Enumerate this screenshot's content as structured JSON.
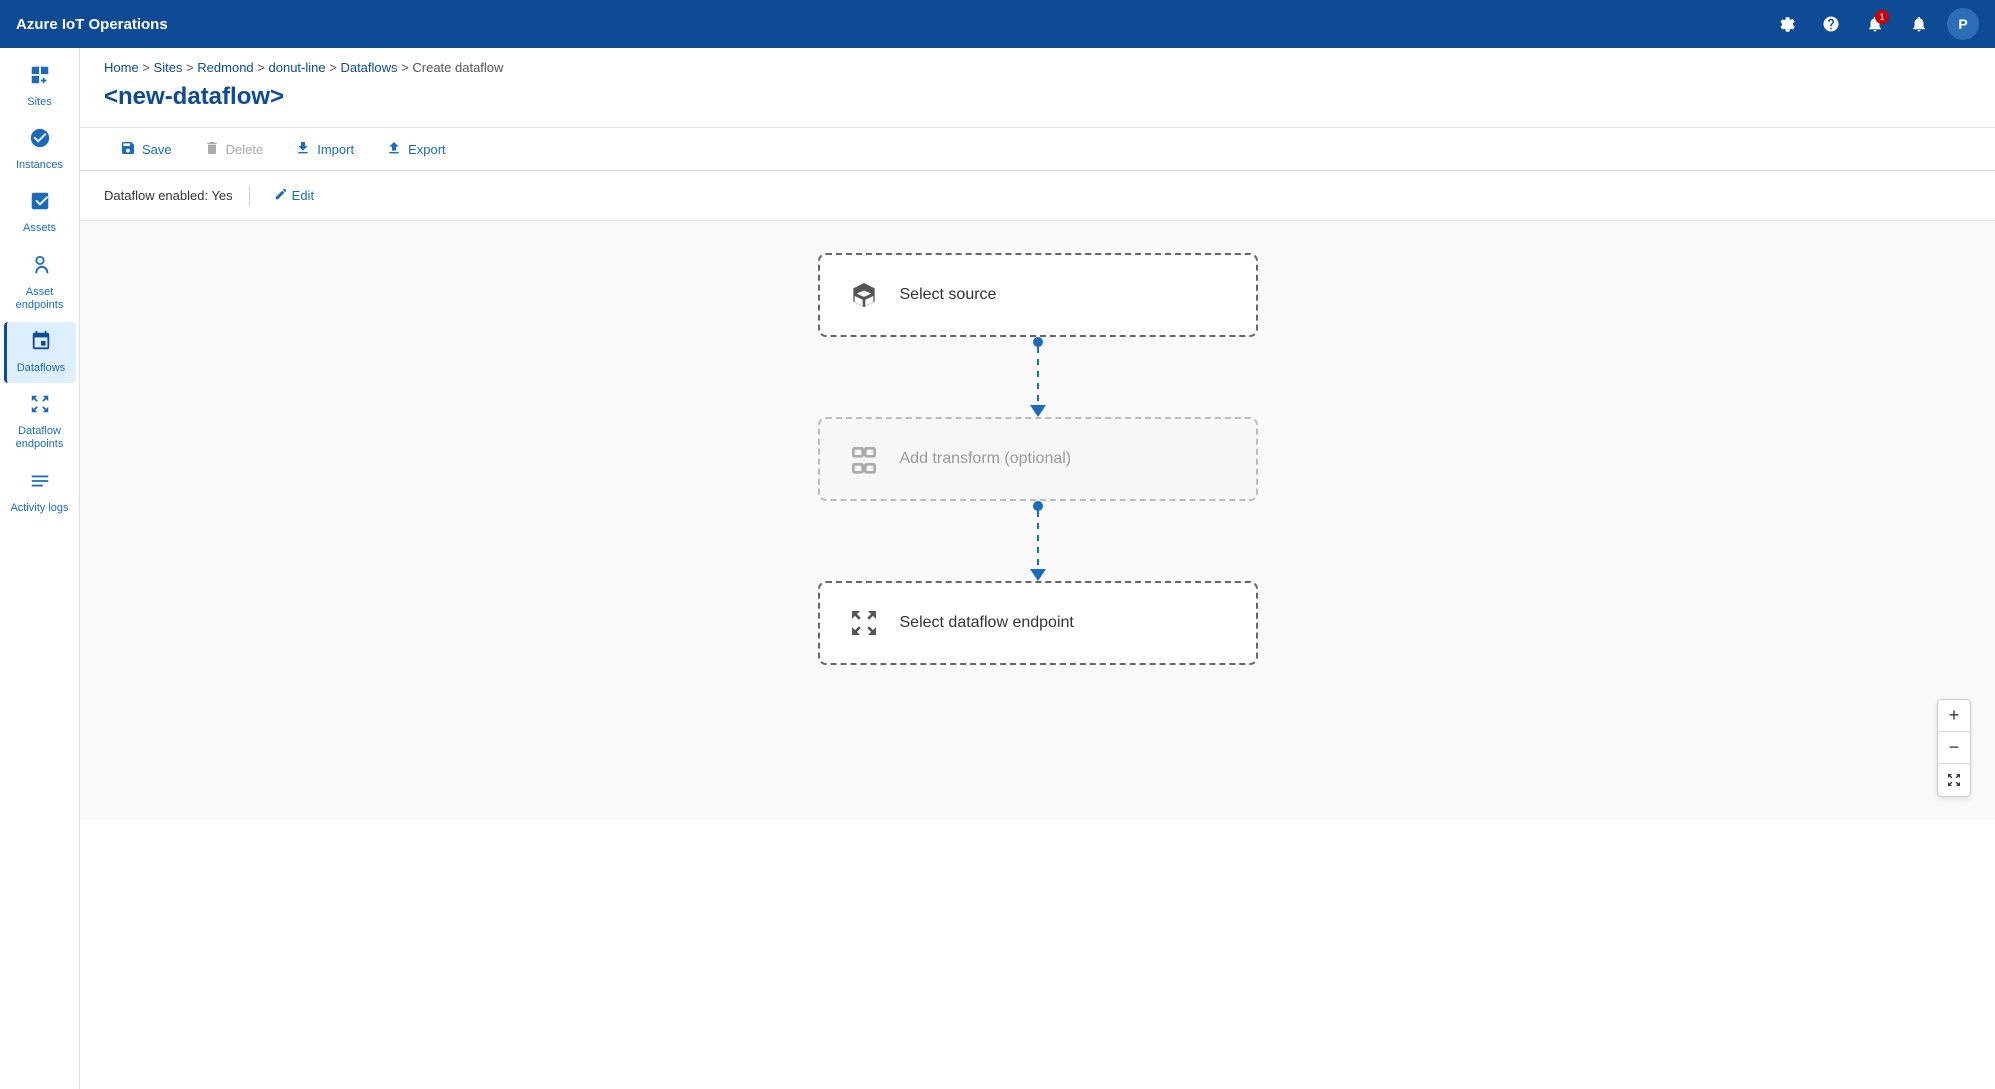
{
  "app": {
    "title": "Azure IoT Operations"
  },
  "topbar": {
    "title": "Azure IoT Operations",
    "icons": {
      "settings": "⚙",
      "help": "?",
      "notifications": "🔔",
      "alerts": "🔔",
      "notification_count": "1",
      "avatar_label": "P"
    }
  },
  "sidebar": {
    "items": [
      {
        "id": "sites",
        "label": "Sites",
        "icon": "⊞"
      },
      {
        "id": "instances",
        "label": "Instances",
        "icon": "⚙"
      },
      {
        "id": "assets",
        "label": "Assets",
        "icon": "◈"
      },
      {
        "id": "asset-endpoints",
        "label": "Asset endpoints",
        "icon": "⬡"
      },
      {
        "id": "dataflows",
        "label": "Dataflows",
        "icon": "⇶",
        "active": true
      },
      {
        "id": "dataflow-endpoints",
        "label": "Dataflow endpoints",
        "icon": "⇹"
      },
      {
        "id": "activity-logs",
        "label": "Activity logs",
        "icon": "≡"
      }
    ]
  },
  "breadcrumb": {
    "parts": [
      "Home",
      "Sites",
      "Redmond",
      "donut-line",
      "Dataflows",
      "Create dataflow"
    ],
    "separators": [
      ">",
      ">",
      ">",
      ">",
      ">"
    ]
  },
  "page": {
    "title": "<new-dataflow>"
  },
  "toolbar": {
    "save_label": "Save",
    "delete_label": "Delete",
    "import_label": "Import",
    "export_label": "Export"
  },
  "info_bar": {
    "status_label": "Dataflow enabled: Yes",
    "edit_label": "Edit"
  },
  "flow": {
    "source_node": {
      "label": "Select source",
      "icon": "📦"
    },
    "transform_node": {
      "label": "Add transform (optional)",
      "icon": "⊞"
    },
    "endpoint_node": {
      "label": "Select dataflow endpoint",
      "icon": "⇹"
    }
  },
  "zoom": {
    "plus_label": "+",
    "minus_label": "−",
    "fit_label": "⊡"
  }
}
